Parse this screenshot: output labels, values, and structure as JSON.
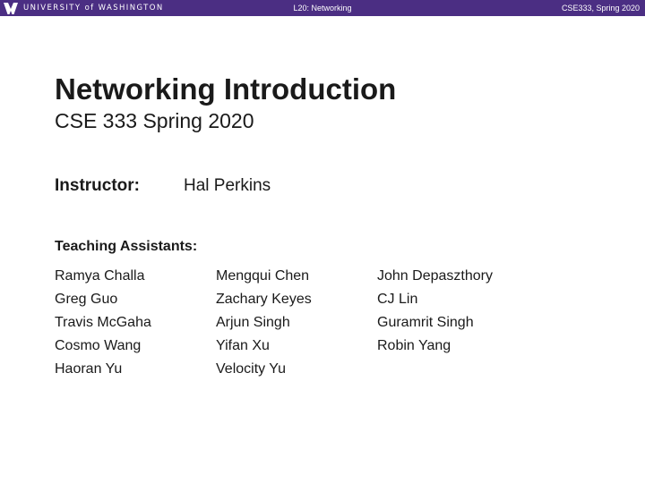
{
  "header": {
    "logo_text": "UNIVERSITY of WASHINGTON",
    "lecture": "L20: Networking",
    "course_term": "CSE333, Spring 2020",
    "bg_color": "#4b2e83"
  },
  "slide": {
    "title": "Networking Introduction",
    "subtitle": "CSE 333 Spring 2020",
    "instructor_label": "Instructor:",
    "instructor_name": "Hal Perkins",
    "ta_label": "Teaching Assistants:",
    "tas": [
      [
        "Ramya Challa",
        "Greg Guo",
        "Travis McGaha",
        "Cosmo Wang",
        "Haoran Yu"
      ],
      [
        "Mengqui Chen",
        "Zachary Keyes",
        "Arjun Singh",
        "Yifan Xu",
        "Velocity Yu"
      ],
      [
        "John Depaszthory",
        "CJ Lin",
        "Guramrit Singh",
        "Robin Yang"
      ]
    ]
  }
}
